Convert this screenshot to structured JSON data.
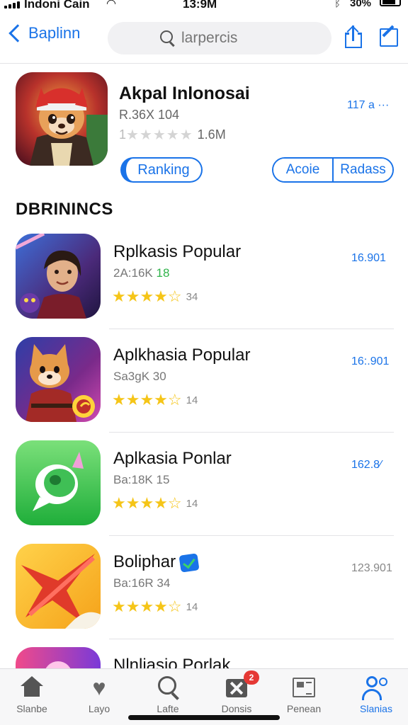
{
  "status_bar": {
    "carrier": "Indoni Cain",
    "time": "13:9M",
    "battery": "30%"
  },
  "nav": {
    "back_label": "Baplinn",
    "search_placeholder": "larpercis"
  },
  "featured": {
    "name": "Akpal Inlonosai",
    "meta": "R.36X 104",
    "rating_prefix": "1",
    "stars": "★★★★★",
    "rating_count": "1.6M",
    "price": "117 a ···",
    "ranking_button": "Ranking",
    "segment": [
      "Acoie",
      "Radass"
    ]
  },
  "section_title": "DBRININCS",
  "apps": [
    {
      "name": "Rplkasis Popular",
      "meta": "2A:16K",
      "meta_highlight": "18",
      "stars": "★★★★",
      "star_empty": "☆",
      "rating_count": "34",
      "price": "16.901",
      "icon": "warrior-icon"
    },
    {
      "name": "Aplkhasia Popular",
      "meta": "Sa3gK 30",
      "meta_highlight": "",
      "stars": "★★★★",
      "star_empty": "☆",
      "rating_count": "14",
      "price": "16:.901",
      "icon": "fox-icon"
    },
    {
      "name": "Aplkasia Ponlar",
      "meta": "Ba:18K 15",
      "meta_highlight": "",
      "stars": "★★★★",
      "star_empty": "☆",
      "rating_count": "14",
      "price": "162.8⁄",
      "icon": "chat-bubble-icon"
    },
    {
      "name": "Boliphar",
      "meta": "Ba:16R 34",
      "meta_highlight": "",
      "stars": "★★★★",
      "star_empty": "☆",
      "rating_count": "14",
      "price": "123.901",
      "icon": "star-shape-icon"
    },
    {
      "name": "Nlnliasio Porlak",
      "meta": "",
      "meta_highlight": "",
      "stars": "",
      "star_empty": "",
      "rating_count": "",
      "price": "",
      "icon": "app-icon"
    }
  ],
  "tabs": [
    {
      "label": "Slanbe",
      "icon": "home-icon"
    },
    {
      "label": "Layo",
      "icon": "heart-icon"
    },
    {
      "label": "Lafte",
      "icon": "search-icon"
    },
    {
      "label": "Donsis",
      "icon": "tools-icon",
      "badge": "2"
    },
    {
      "label": "Penean",
      "icon": "news-icon"
    },
    {
      "label": "Slanias",
      "icon": "people-icon"
    }
  ],
  "colors": {
    "accent": "#1a73e8",
    "star": "#f5c518",
    "badge": "#e53935"
  }
}
